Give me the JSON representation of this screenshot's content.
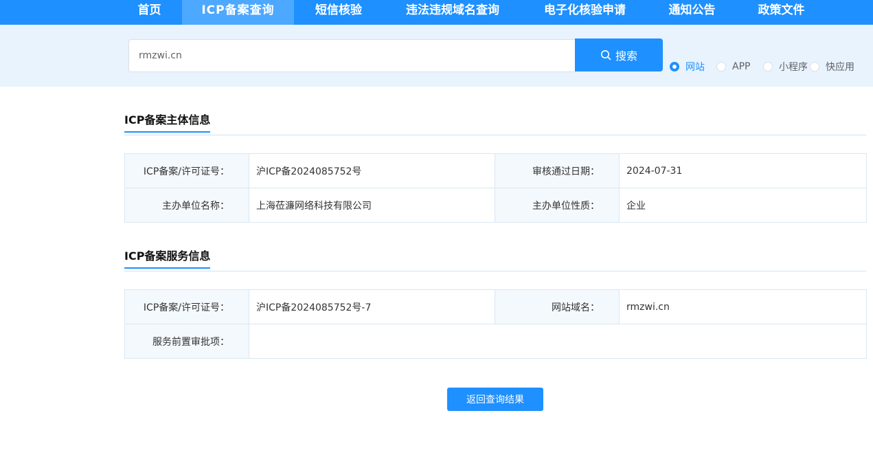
{
  "nav": {
    "items": [
      {
        "label": "首页"
      },
      {
        "label": "ICP备案查询"
      },
      {
        "label": "短信核验"
      },
      {
        "label": "违法违规域名查询"
      },
      {
        "label": "电子化核验申请"
      },
      {
        "label": "通知公告"
      },
      {
        "label": "政策文件"
      }
    ],
    "active_index": 1
  },
  "search": {
    "value": "rmzwi.cn",
    "button_label": "搜索",
    "button_icon": "search-icon",
    "types": [
      {
        "label": "网站",
        "checked": true
      },
      {
        "label": "APP",
        "checked": false
      },
      {
        "label": "小程序",
        "checked": false
      },
      {
        "label": "快应用",
        "checked": false
      }
    ]
  },
  "subject_section": {
    "title": "ICP备案主体信息",
    "rows": [
      [
        {
          "key": "ICP备案/许可证号：",
          "value": "沪ICP备2024085752号"
        },
        {
          "key": "审核通过日期：",
          "value": "2024-07-31"
        }
      ],
      [
        {
          "key": "主办单位名称：",
          "value": "上海莅濂网络科技有限公司"
        },
        {
          "key": "主办单位性质：",
          "value": "企业"
        }
      ]
    ]
  },
  "service_section": {
    "title": "ICP备案服务信息",
    "rows": [
      [
        {
          "key": "ICP备案/许可证号：",
          "value": "沪ICP备2024085752号-7"
        },
        {
          "key": "网站域名：",
          "value": "rmzwi.cn"
        }
      ],
      [
        {
          "key": "服务前置审批项：",
          "value": ""
        }
      ]
    ]
  },
  "back_button": {
    "label": "返回查询结果"
  },
  "colors": {
    "primary": "#1e90ff",
    "nav_active": "#4da8ff",
    "search_band": "#e8f3fe",
    "key_cell": "#f4f9fd"
  }
}
